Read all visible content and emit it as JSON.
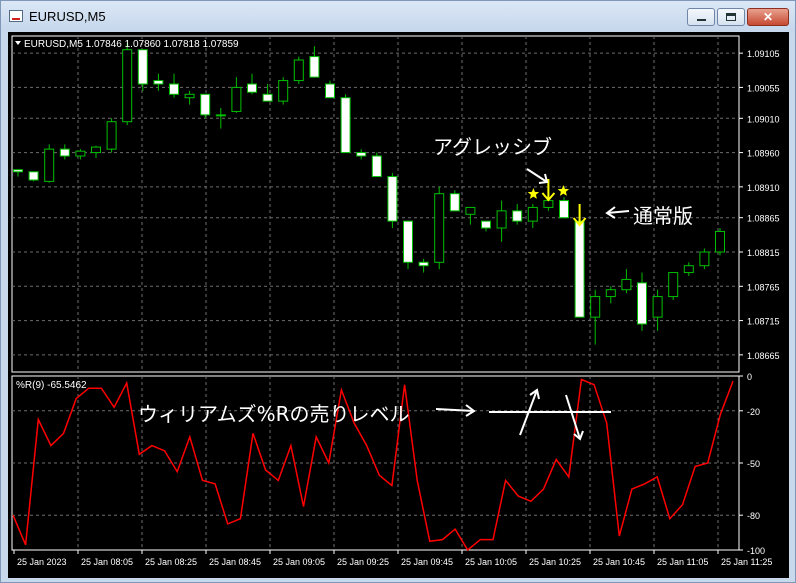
{
  "window": {
    "title": "EURUSD,M5"
  },
  "chart_data": [
    {
      "type": "candlestick",
      "label": "EURUSD,M5  1.07846 1.07860 1.07818 1.07859",
      "ylim": [
        1.0864,
        1.0913
      ],
      "y_ticks": [
        "1.09105",
        "1.09055",
        "1.09010",
        "1.08960",
        "1.08910",
        "1.08865",
        "1.08815",
        "1.08765",
        "1.08715",
        "1.08665"
      ],
      "grid": true,
      "candles": [
        [
          1.08935,
          1.08935,
          1.08925,
          1.08932
        ],
        [
          1.08932,
          1.08932,
          1.08918,
          1.0892
        ],
        [
          1.08918,
          1.08972,
          1.08916,
          1.08965
        ],
        [
          1.08965,
          1.08972,
          1.0895,
          1.08955
        ],
        [
          1.08955,
          1.08965,
          1.0895,
          1.08962
        ],
        [
          1.0896,
          1.0897,
          1.08952,
          1.08968
        ],
        [
          1.08965,
          1.0901,
          1.0896,
          1.09005
        ],
        [
          1.09005,
          1.0912,
          1.09,
          1.0911
        ],
        [
          1.0911,
          1.0911,
          1.0905,
          1.0906
        ],
        [
          1.09065,
          1.09075,
          1.0905,
          1.0906
        ],
        [
          1.0906,
          1.09075,
          1.0904,
          1.09045
        ],
        [
          1.0904,
          1.0905,
          1.0903,
          1.09045
        ],
        [
          1.09045,
          1.09045,
          1.0901,
          1.09015
        ],
        [
          1.09015,
          1.09025,
          1.08995,
          1.09015
        ],
        [
          1.0902,
          1.0907,
          1.09018,
          1.09055
        ],
        [
          1.0906,
          1.09075,
          1.09045,
          1.09048
        ],
        [
          1.09045,
          1.0906,
          1.09035,
          1.09035
        ],
        [
          1.09035,
          1.0907,
          1.0903,
          1.09065
        ],
        [
          1.09065,
          1.091,
          1.0906,
          1.09095
        ],
        [
          1.091,
          1.09115,
          1.0907,
          1.0907
        ],
        [
          1.0906,
          1.09065,
          1.0904,
          1.0904
        ],
        [
          1.0904,
          1.09045,
          1.0896,
          1.0896
        ],
        [
          1.0896,
          1.08965,
          1.0895,
          1.08955
        ],
        [
          1.08955,
          1.0896,
          1.08925,
          1.08925
        ],
        [
          1.08925,
          1.0893,
          1.0885,
          1.0886
        ],
        [
          1.0886,
          1.0886,
          1.0879,
          1.088
        ],
        [
          1.088,
          1.08805,
          1.08785,
          1.08795
        ],
        [
          1.088,
          1.0891,
          1.0879,
          1.089
        ],
        [
          1.089,
          1.08905,
          1.08875,
          1.08875
        ],
        [
          1.0887,
          1.0888,
          1.08855,
          1.0888
        ],
        [
          1.0886,
          1.0886,
          1.08845,
          1.0885
        ],
        [
          1.0885,
          1.0889,
          1.0883,
          1.08875
        ],
        [
          1.08875,
          1.08885,
          1.08855,
          1.0886
        ],
        [
          1.0886,
          1.08885,
          1.0885,
          1.0888
        ],
        [
          1.0888,
          1.089,
          1.08875,
          1.0889
        ],
        [
          1.0889,
          1.08895,
          1.08865,
          1.08865
        ],
        [
          1.0886,
          1.0886,
          1.0872,
          1.0872
        ],
        [
          1.0872,
          1.0876,
          1.0868,
          1.0875
        ],
        [
          1.0875,
          1.08765,
          1.0874,
          1.0876
        ],
        [
          1.0876,
          1.0879,
          1.08755,
          1.08775
        ],
        [
          1.0877,
          1.08785,
          1.087,
          1.0871
        ],
        [
          1.0872,
          1.0876,
          1.087,
          1.0875
        ],
        [
          1.0875,
          1.08785,
          1.08745,
          1.08785
        ],
        [
          1.08785,
          1.088,
          1.0878,
          1.08795
        ],
        [
          1.08795,
          1.0882,
          1.0879,
          1.08815
        ],
        [
          1.08815,
          1.0885,
          1.0881,
          1.08845
        ]
      ]
    },
    {
      "type": "line",
      "label": "%R(9) -65.5462",
      "ylim": [
        -100,
        0
      ],
      "y_ticks": [
        "0",
        "-20",
        "-50",
        "-80",
        "-100"
      ],
      "series": [
        {
          "values": [
            -80,
            -97,
            -25,
            -40,
            -33,
            -13,
            -7,
            -7,
            -18,
            -4,
            -45,
            -40,
            -43,
            -55,
            -35,
            -60,
            -62,
            -85,
            -82,
            -33,
            -54,
            -60,
            -40,
            -75,
            -35,
            -50,
            -8,
            -27,
            -40,
            -57,
            -63,
            -5,
            -60,
            -95,
            -94,
            -88,
            -100,
            -94,
            -94,
            -60,
            -69,
            -72,
            -65,
            -48,
            -58,
            -2,
            -5,
            -27,
            -92,
            -65,
            -62,
            -58,
            -82,
            -74,
            -52,
            -50,
            -22,
            -3
          ]
        }
      ]
    }
  ],
  "x_ticks": [
    "25 Jan 2023",
    "25 Jan 08:05",
    "25 Jan 08:25",
    "25 Jan 08:45",
    "25 Jan 09:05",
    "25 Jan 09:25",
    "25 Jan 09:45",
    "25 Jan 10:05",
    "25 Jan 10:25",
    "25 Jan 10:45",
    "25 Jan 11:05",
    "25 Jan 11:25"
  ],
  "annotations": {
    "aggressive": "アグレッシブ",
    "normal": "通常版",
    "wr_label": "ウィリアムズ%Rの売りレベル"
  },
  "colors": {
    "bg": "#000000",
    "candle": "#00c000",
    "wr_line": "#ff0000",
    "annotation": "#ffff00"
  }
}
